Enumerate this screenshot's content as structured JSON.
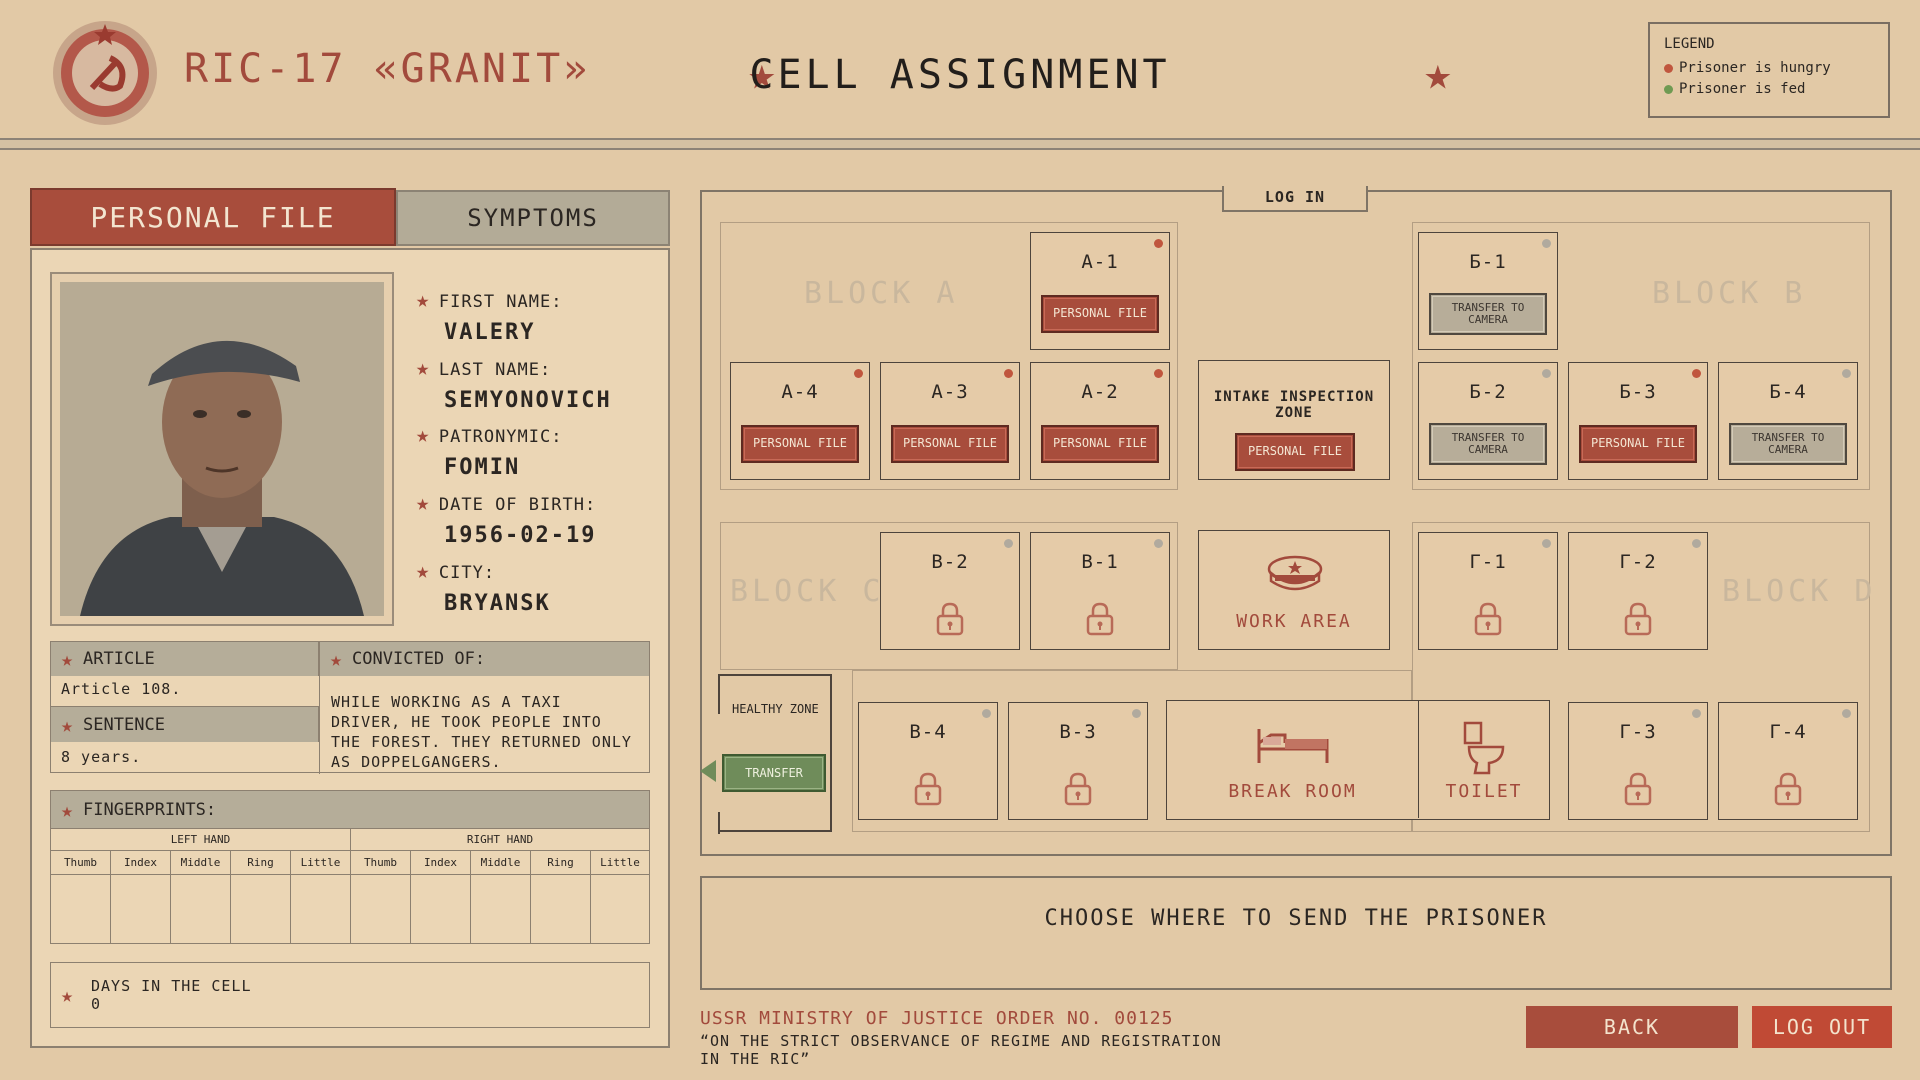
{
  "header": {
    "facility_title": "RIC-17 «GRANIT»",
    "page_title": "CELL ASSIGNMENT",
    "emblem_icon": "hammer-sickle-emblem-icon",
    "legend": {
      "title": "LEGEND",
      "hungry_label": "Prisoner is hungry",
      "fed_label": "Prisoner is fed",
      "hungry_color": "#c0563e",
      "fed_color": "#6f9a52"
    }
  },
  "tabs": {
    "personal_file": "PERSONAL FILE",
    "symptoms": "SYMPTOMS"
  },
  "prisoner": {
    "first_name_label": "FIRST NAME:",
    "first_name": "VALERY",
    "last_name_label": "LAST NAME:",
    "last_name": "SEMYONOVICH",
    "patronymic_label": "PATRONYMIC:",
    "patronymic": "FOMIN",
    "dob_label": "DATE OF BIRTH:",
    "dob": "1956-02-19",
    "city_label": "CITY:",
    "city": "BRYANSK",
    "article_label": "ARTICLE",
    "article": "Article 108.",
    "sentence_label": "SENTENCE",
    "sentence": "8 years.",
    "convicted_label": "CONVICTED OF:",
    "convicted_text": "WHILE WORKING AS A TAXI DRIVER, HE TOOK PEOPLE INTO THE FOREST. THEY RETURNED ONLY AS DOPPELGANGERS.",
    "fingerprints_label": "FINGERPRINTS:",
    "left_hand": "LEFT HAND",
    "right_hand": "RIGHT HAND",
    "fingers": [
      "Thumb",
      "Index",
      "Middle",
      "Ring",
      "Little",
      "Thumb",
      "Index",
      "Middle",
      "Ring",
      "Little"
    ],
    "days_label": "DAYS IN THE CELL",
    "days_value": "0"
  },
  "map": {
    "login_tab": "LOG IN",
    "block_a": "BLOCK A",
    "block_b": "BLOCK B",
    "block_c": "BLOCK C",
    "block_d": "BLOCK D",
    "personal_file_btn": "PERSONAL FILE",
    "transfer_camera_btn": "TRANSFER TO CAMERA",
    "cells": {
      "a1": "A-1",
      "a2": "A-2",
      "a3": "A-3",
      "a4": "A-4",
      "b1": "Б-1",
      "b2": "Б-2",
      "b3": "Б-3",
      "b4": "Б-4",
      "v1": "В-1",
      "v2": "В-2",
      "v3": "В-3",
      "v4": "В-4",
      "g1": "Г-1",
      "g2": "Г-2",
      "g3": "Г-3",
      "g4": "Г-4"
    },
    "intake_zone": "INTAKE INSPECTION ZONE",
    "work_area": "WORK AREA",
    "break_room": "BREAK ROOM",
    "toilet": "TOILET",
    "healthy_zone": "HEALTHY ZONE",
    "transfer_btn": "TRANSFER"
  },
  "footer": {
    "instruction": "CHOOSE WHERE TO SEND THE PRISONER",
    "order_title": "USSR MINISTRY OF JUSTICE ORDER NO. 00125",
    "order_line1": "“ON THE STRICT OBSERVANCE OF REGIME AND REGISTRATION",
    "order_line2": "IN THE RIC”",
    "back": "BACK",
    "logout": "LOG OUT"
  }
}
